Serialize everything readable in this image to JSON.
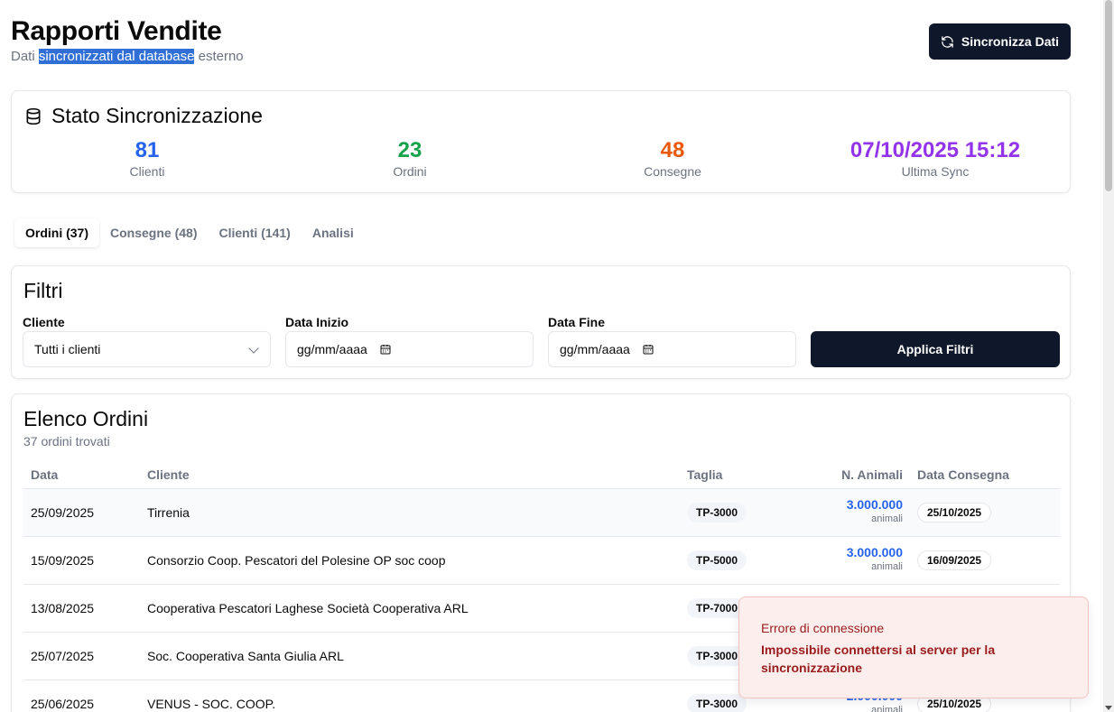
{
  "header": {
    "title": "Rapporti Vendite",
    "subtitle_pre": "Dati ",
    "subtitle_sel": "sincronizzati dal database",
    "subtitle_post": " esterno",
    "sync_button": "Sincronizza Dati"
  },
  "sync_status": {
    "title": "Stato Sincronizzazione",
    "stats": [
      {
        "value": "81",
        "label": "Clienti",
        "color": "#2563eb"
      },
      {
        "value": "23",
        "label": "Ordini",
        "color": "#16a34a"
      },
      {
        "value": "48",
        "label": "Consegne",
        "color": "#ea580c"
      },
      {
        "value": "07/10/2025 15:12",
        "label": "Ultima Sync",
        "color": "#9333ea"
      }
    ]
  },
  "tabs": [
    {
      "label": "Ordini (37)",
      "active": true
    },
    {
      "label": "Consegne (48)",
      "active": false
    },
    {
      "label": "Clienti (141)",
      "active": false
    },
    {
      "label": "Analisi",
      "active": false
    }
  ],
  "filters": {
    "title": "Filtri",
    "cliente_label": "Cliente",
    "cliente_value": "Tutti i clienti",
    "data_inizio_label": "Data Inizio",
    "data_inizio_placeholder": "gg/mm/aaaa",
    "data_fine_label": "Data Fine",
    "data_fine_placeholder": "gg/mm/aaaa",
    "apply_button": "Applica Filtri"
  },
  "orders": {
    "title": "Elenco Ordini",
    "count_text": "37 ordini trovati",
    "columns": [
      "Data",
      "Cliente",
      "Taglia",
      "N. Animali",
      "Data Consegna"
    ],
    "rows": [
      {
        "data": "25/09/2025",
        "cliente": "Tirrenia",
        "taglia": "TP-3000",
        "animali": "3.000.000",
        "unit": "animali",
        "consegna": "25/10/2025"
      },
      {
        "data": "15/09/2025",
        "cliente": "Consorzio Coop. Pescatori del Polesine OP soc coop",
        "taglia": "TP-5000",
        "animali": "3.000.000",
        "unit": "animali",
        "consegna": "16/09/2025"
      },
      {
        "data": "13/08/2025",
        "cliente": "Cooperativa Pescatori Laghese Società Cooperativa ARL",
        "taglia": "TP-7000",
        "animali": "",
        "unit": "",
        "consegna": ""
      },
      {
        "data": "25/07/2025",
        "cliente": "Soc. Cooperativa Santa Giulia ARL",
        "taglia": "TP-3000",
        "animali": "",
        "unit": "",
        "consegna": ""
      },
      {
        "data": "25/06/2025",
        "cliente": "VENUS - SOC. COOP.",
        "taglia": "TP-3000",
        "animali": "2.000.000",
        "unit": "animali",
        "consegna": "25/10/2025"
      }
    ]
  },
  "toast": {
    "title": "Errore di connessione",
    "description": "Impossibile connettersi al server per la sincronizzazione"
  }
}
